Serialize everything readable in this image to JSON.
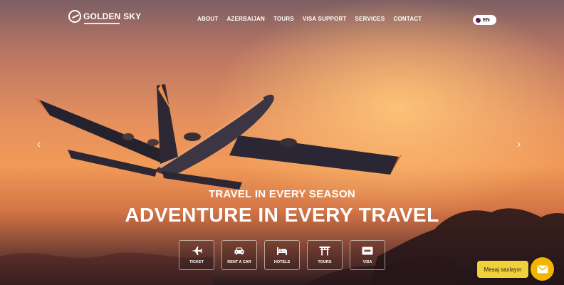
{
  "brand": {
    "name": "GOLDEN SKY"
  },
  "nav": {
    "items": [
      "ABOUT",
      "AZERBAIJAN",
      "TOURS",
      "VISA SUPPORT",
      "SERVICES",
      "CONTACT"
    ]
  },
  "language": {
    "label": "EN"
  },
  "hero": {
    "tagline": "TRAVEL IN EVERY SEASON",
    "headline": "ADVENTURE IN EVERY TRAVEL"
  },
  "services": [
    {
      "label": "TICKET",
      "icon": "plane-icon"
    },
    {
      "label": "RENT A CAR",
      "icon": "car-icon"
    },
    {
      "label": "HOTELS",
      "icon": "bed-icon"
    },
    {
      "label": "TOURS",
      "icon": "torii-icon"
    },
    {
      "label": "VISA",
      "icon": "visa-card-icon"
    }
  ],
  "slider": {
    "prev": "‹",
    "next": "›"
  },
  "chat": {
    "label": "Mesaj saxlayın",
    "icon": "mail-icon"
  },
  "colors": {
    "accent": "#f1b400",
    "chat_label_bg": "#f1d13a"
  }
}
